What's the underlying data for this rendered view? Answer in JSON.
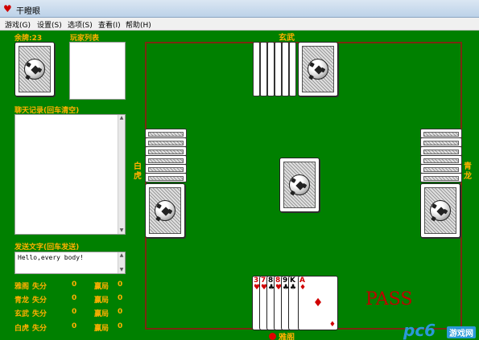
{
  "window": {
    "title": "干瞪眼",
    "app_icon": "heart-icon"
  },
  "menu": [
    "游戏(G)",
    "设置(S)",
    "选项(S)",
    "查看(I)",
    "帮助(H)"
  ],
  "sidebar": {
    "remaining_label": "余牌:23",
    "player_list_label": "玩家列表",
    "chat_label": "聊天记录(回车清空)",
    "send_label": "发送文字(回车发送)",
    "send_text": "Hello,every body!"
  },
  "scores": [
    {
      "name": "雅阁",
      "lose_label": "失分",
      "lose": "0",
      "win_label": "赢局",
      "win": "0"
    },
    {
      "name": "青龙",
      "lose_label": "失分",
      "lose": "0",
      "win_label": "赢局",
      "win": "0"
    },
    {
      "name": "玄武",
      "lose_label": "失分",
      "lose": "0",
      "win_label": "赢局",
      "win": "0"
    },
    {
      "name": "白虎",
      "lose_label": "失分",
      "lose": "0",
      "win_label": "赢局",
      "win": "0"
    }
  ],
  "table": {
    "top_player": "玄武",
    "left_player": "白虎",
    "right_player": "青龙",
    "bottom_player": "雅阁",
    "status_text": "PASS",
    "hand": [
      {
        "rank": "3",
        "suit": "♥",
        "color": "red"
      },
      {
        "rank": "7",
        "suit": "♥",
        "color": "red"
      },
      {
        "rank": "8",
        "suit": "♣",
        "color": "black"
      },
      {
        "rank": "8",
        "suit": "♥",
        "color": "red"
      },
      {
        "rank": "9",
        "suit": "♣",
        "color": "black"
      },
      {
        "rank": "K",
        "suit": "♣",
        "color": "black"
      },
      {
        "rank": "A",
        "suit": "♦",
        "color": "red"
      }
    ]
  },
  "watermark": {
    "logo": "pc6",
    "text": "游戏网"
  },
  "colors": {
    "felt": "#008000",
    "label": "#ffb000",
    "border": "#7a2a10",
    "pass": "#c00000"
  }
}
